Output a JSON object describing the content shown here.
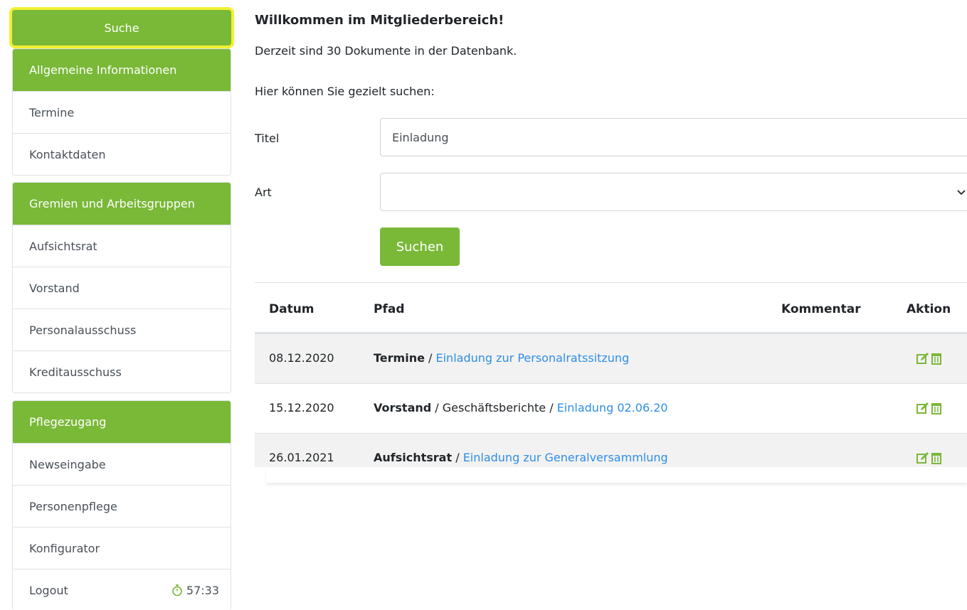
{
  "sidebar": {
    "search_label": "Suche",
    "groups": [
      {
        "header": "Allgemeine Informationen",
        "items": [
          "Termine",
          "Kontaktdaten"
        ]
      },
      {
        "header": "Gremien und Arbeitsgruppen",
        "items": [
          "Aufsichtsrat",
          "Vorstand",
          "Personalausschuss",
          "Kreditausschuss"
        ]
      },
      {
        "header": "Pflegezugang",
        "items": [
          "Newseingabe",
          "Personenpflege",
          "Konfigurator"
        ]
      }
    ],
    "logout_label": "Logout",
    "session_timer": "57:33"
  },
  "main": {
    "title": "Willkommen im Mitgliederbereich!",
    "doc_count_text": "Derzeit sind 30 Dokumente in der Datenbank.",
    "search_hint": "Hier können Sie gezielt suchen:",
    "form": {
      "title_label": "Titel",
      "title_value": "Einladung",
      "type_label": "Art",
      "type_value": "",
      "submit_label": "Suchen"
    },
    "table": {
      "headers": [
        "Datum",
        "Pfad",
        "Kommentar",
        "Aktion"
      ],
      "rows": [
        {
          "date": "08.12.2020",
          "category": "Termine",
          "sub": "",
          "link": "Einladung zur Personalratssitzung"
        },
        {
          "date": "15.12.2020",
          "category": "Vorstand",
          "sub": "Geschäftsberichte",
          "link": "Einladung 02.06.20"
        },
        {
          "date": "26.01.2021",
          "category": "Aufsichtsrat",
          "sub": "",
          "link": "Einladung zur Generalversammlung"
        }
      ]
    }
  },
  "colors": {
    "accent": "#7ab838",
    "link": "#2e8ee8",
    "highlight": "#f2f033",
    "stripe": "#f2f2f2"
  }
}
